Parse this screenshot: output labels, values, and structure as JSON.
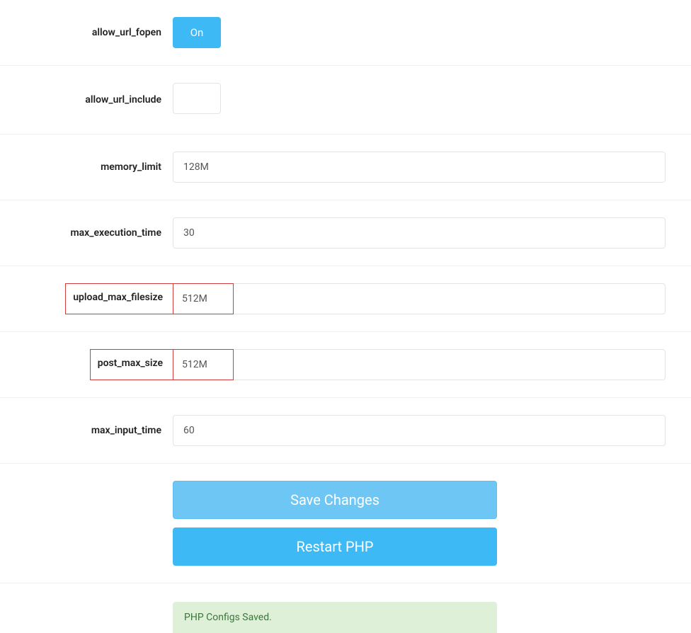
{
  "form": {
    "allow_url_fopen": {
      "label": "allow_url_fopen",
      "state": "On"
    },
    "allow_url_include": {
      "label": "allow_url_include"
    },
    "memory_limit": {
      "label": "memory_limit",
      "value": "128M"
    },
    "max_execution_time": {
      "label": "max_execution_time",
      "value": "30"
    },
    "upload_max_filesize": {
      "label": "upload_max_filesize",
      "value": "512M"
    },
    "post_max_size": {
      "label": "post_max_size",
      "value": "512M"
    },
    "max_input_time": {
      "label": "max_input_time",
      "value": "60"
    }
  },
  "buttons": {
    "save": "Save Changes",
    "restart": "Restart PHP"
  },
  "alert": {
    "saved": "PHP Configs Saved."
  }
}
